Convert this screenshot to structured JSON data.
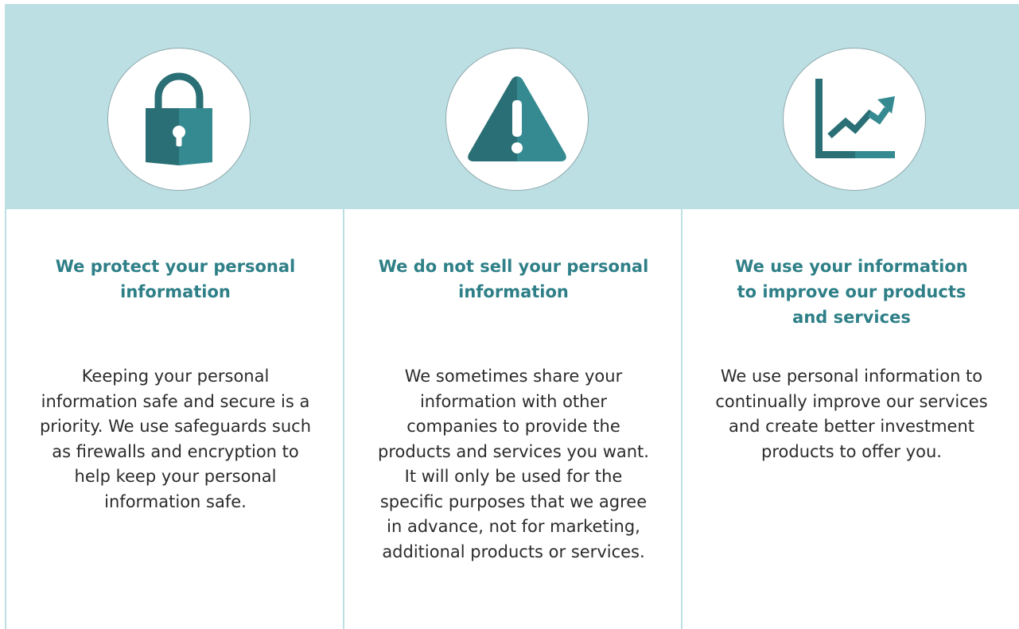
{
  "columns": [
    {
      "icon": "lock-icon",
      "heading": "We protect your personal\ninformation",
      "body": "Keeping your personal\ninformation safe and secure is a\npriority. We use safeguards such\nas firewalls and encryption to\nhelp keep your personal\ninformation safe."
    },
    {
      "icon": "warning-icon",
      "heading": "We do not sell your personal\ninformation",
      "body": "We sometimes share your\ninformation with other\ncompanies to provide the\nproducts and services you want.\nIt will only be used for the\nspecific purposes that we agree\nin advance, not for marketing,\nadditional products or services."
    },
    {
      "icon": "growth-chart-icon",
      "heading": "We use your information\nto improve our products\nand services",
      "body": "We use personal information to\ncontinually improve our services\nand create better investment\nproducts to offer you."
    }
  ],
  "colors": {
    "banner": "#bcdfe3",
    "accent": "#2e7f87",
    "icon_dark": "#2a6f75",
    "icon_light": "#358a91",
    "body_text": "#2b2b2b"
  }
}
